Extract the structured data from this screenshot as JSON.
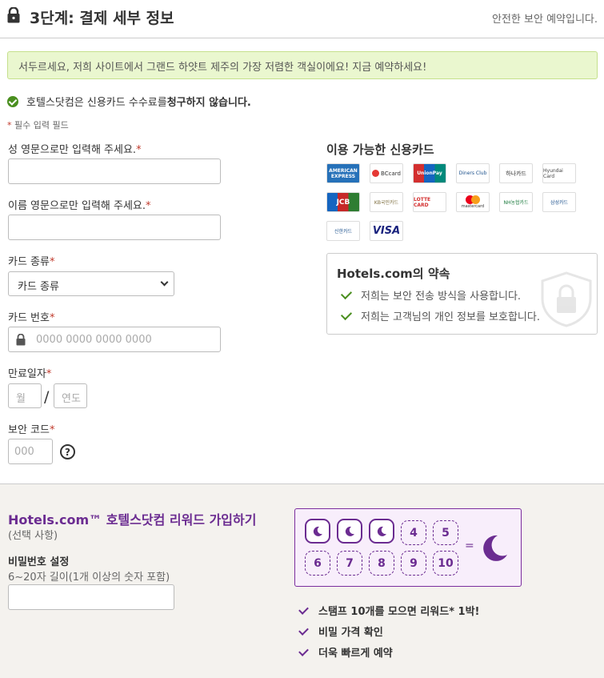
{
  "header": {
    "title": "3단계: 결제 세부 정보",
    "secure_text": "안전한 보안 예약입니다."
  },
  "banner": {
    "text": "서두르세요, 저희 사이트에서 그랜드 하얏트 제주의 가장 저렴한 객실이에요! 지금 예약하세요!"
  },
  "no_fee": {
    "prefix": "호텔스닷컴은 신용카드 수수료를 ",
    "bold": "청구하지 않습니다."
  },
  "required_note": {
    "star": "*",
    "text": " 필수 입력 필드"
  },
  "form": {
    "last_name_label": "성 영문으로만 입력해 주세요.",
    "first_name_label": "이름 영문으로만 입력해 주세요.",
    "card_type_label": "카드 종류",
    "card_type_value": "카드 종류",
    "card_number_label": "카드 번호",
    "card_number_placeholder": "0000 0000 0000 0000",
    "expiry_label": "만료일자",
    "month_placeholder": "월",
    "year_placeholder": "연도",
    "slash": "/",
    "cvv_label": "보안 코드",
    "cvv_placeholder": "000",
    "help": "?",
    "star": "*"
  },
  "cards": {
    "title": "이용 가능한 신용카드",
    "logos": [
      "AMERICAN EXPRESS",
      "BCcard",
      "UnionPay",
      "Diners Club",
      "하나카드",
      "Hyundai Card",
      "JCB",
      "KB국민카드",
      "LOTTE CARD",
      "mastercard",
      "NH농협카드",
      "삼성카드",
      "신한카드",
      "VISA"
    ]
  },
  "promise": {
    "title": "Hotels.com의 약속",
    "items": [
      "저희는 보안 전송 방식을 사용합니다.",
      "저희는 고객님의 개인 정보를 보호합니다."
    ]
  },
  "rewards": {
    "title": "Hotels.com™ 호텔스닷컴 리워드 가입하기",
    "subtitle": "(선택 사항)",
    "password_label": "비밀번호 설정",
    "password_hint": "6~20자 길이(1개 이상의 숫자 포함)",
    "stamps": [
      "4",
      "5",
      "6",
      "7",
      "8",
      "9",
      "10"
    ],
    "equals": "=",
    "benefits": [
      "스탬프 10개를 모으면 리워드* 1박!",
      "비밀 가격 확인",
      "더욱 빠르게 예약"
    ]
  },
  "colors": {
    "brand_purple": "#6b2c91",
    "check_green": "#4a8f1f",
    "banner_bg": "#eaf7cf"
  }
}
